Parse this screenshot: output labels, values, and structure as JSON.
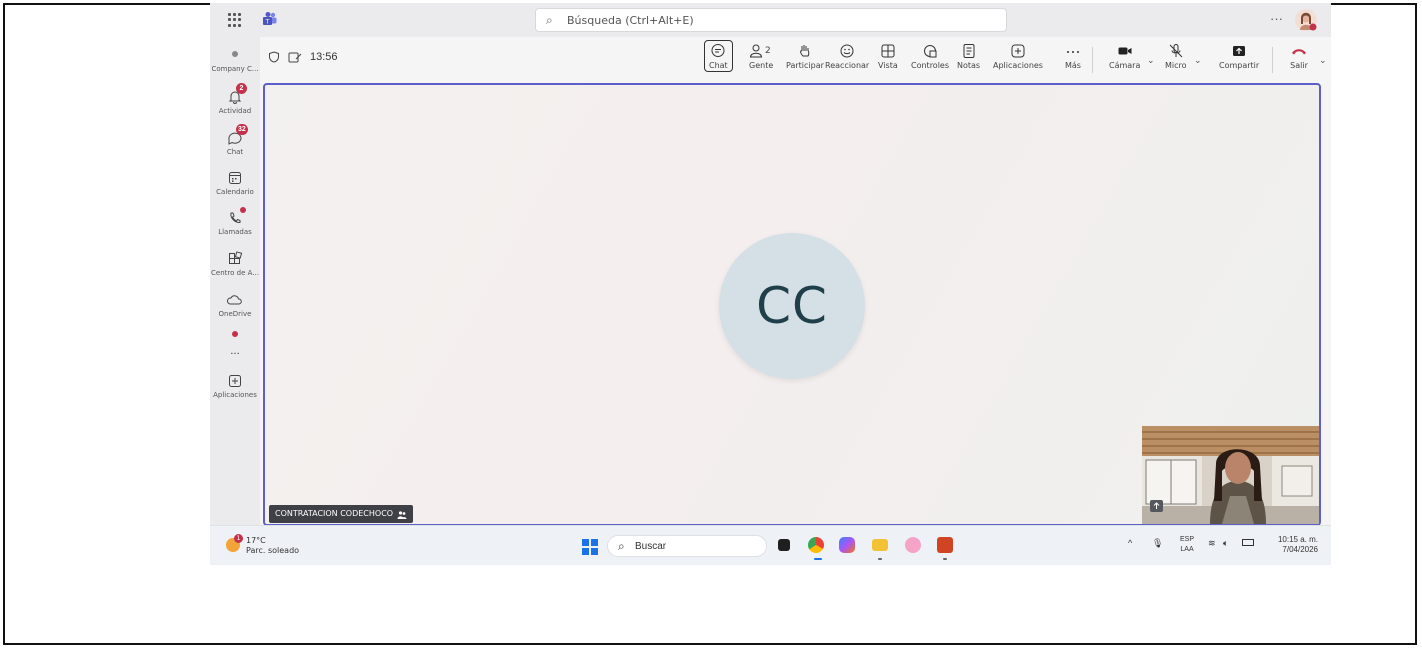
{
  "titlebar": {
    "search_placeholder": "Búsqueda (Ctrl+Alt+E)",
    "more": "···"
  },
  "sidebar": {
    "items": [
      {
        "label": "Company C..."
      },
      {
        "label": "Actividad",
        "badge": "2"
      },
      {
        "label": "Chat",
        "badge": "32"
      },
      {
        "label": "Calendario"
      },
      {
        "label": "Llamadas"
      },
      {
        "label": "Centro de A..."
      },
      {
        "label": "OneDrive"
      },
      {
        "label": "···"
      },
      {
        "label": "Aplicaciones"
      }
    ]
  },
  "meeting": {
    "time": "13:56",
    "participants_count": "2",
    "tools": {
      "chat": "Chat",
      "gente": "Gente",
      "participar": "Participar",
      "reaccionar": "Reaccionar",
      "vista": "Vista",
      "controles": "Controles",
      "notas": "Notas",
      "aplicaciones": "Aplicaciones",
      "mas": "Más",
      "camara": "Cámara",
      "micro": "Micro",
      "compartir": "Compartir",
      "salir": "Salir"
    },
    "avatar_initials": "CC",
    "name_tag": "CONTRATACION CODECHOCO"
  },
  "taskbar": {
    "temp": "17°C",
    "weather_text": "Parc. soleado",
    "weather_badge": "1",
    "search_label": "Buscar",
    "lang_top": "ESP",
    "lang_bottom": "LAA",
    "time": "10:15 a. m.",
    "date": "7/04/2026"
  },
  "colors": {
    "accent": "#5b5fc7",
    "badge": "#c4314b",
    "leave": "#c4314b"
  }
}
